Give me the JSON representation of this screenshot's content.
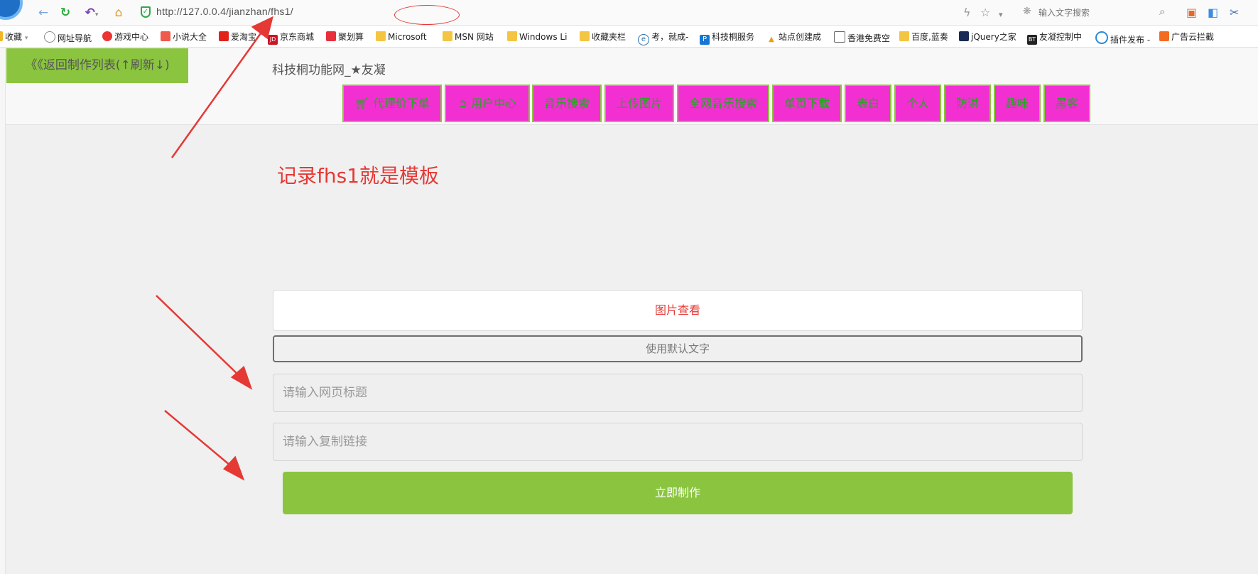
{
  "browser": {
    "url": "http://127.0.0.4/jianzhan/fhs1/",
    "search_placeholder": "输入文字搜索"
  },
  "bookmarks": [
    {
      "label": "收藏",
      "icon": "star-icon"
    },
    {
      "label": "网址导航",
      "icon": "globe-icon"
    },
    {
      "label": "游戏中心",
      "icon": "game-icon"
    },
    {
      "label": "小说大全",
      "icon": "book-icon"
    },
    {
      "label": "爱淘宝",
      "icon": "taobao-icon"
    },
    {
      "label": "京东商城",
      "icon": "jd-icon"
    },
    {
      "label": "聚划算",
      "icon": "juhuasuan-icon"
    },
    {
      "label": "Microsoft",
      "icon": "folder-icon"
    },
    {
      "label": "MSN 网站",
      "icon": "folder-icon"
    },
    {
      "label": "Windows Li",
      "icon": "folder-icon"
    },
    {
      "label": "收藏夹栏",
      "icon": "folder-icon"
    },
    {
      "label": "考，就成-",
      "icon": "e-icon"
    },
    {
      "label": "科技桐服务",
      "icon": "p-icon"
    },
    {
      "label": "站点创建成",
      "icon": "site-icon"
    },
    {
      "label": "香港免费空",
      "icon": "page-icon"
    },
    {
      "label": "百度,蓝奏",
      "icon": "folder-img-icon"
    },
    {
      "label": "jQuery之家",
      "icon": "jquery-icon"
    },
    {
      "label": "友凝控制中",
      "icon": "bt-icon"
    },
    {
      "label": "插件发布 -",
      "icon": "plugin-icon"
    },
    {
      "label": "广告云拦截",
      "icon": "flag-icon"
    }
  ],
  "page": {
    "back_label": "《《返回制作列表(↑刷新↓)",
    "site_title": "科技桐功能网_★友凝",
    "nav": [
      {
        "label": "代理价下单",
        "icon": "cart-icon"
      },
      {
        "label": "用户中心",
        "icon": "signout-icon"
      },
      {
        "label": "音乐搜索",
        "icon": ""
      },
      {
        "label": "上传图片",
        "icon": ""
      },
      {
        "label": "全网音乐搜索",
        "icon": ""
      },
      {
        "label": "单页下载",
        "icon": ""
      },
      {
        "label": "表白",
        "icon": ""
      },
      {
        "label": "个人",
        "icon": ""
      },
      {
        "label": "防洪",
        "icon": ""
      },
      {
        "label": "趣味",
        "icon": ""
      },
      {
        "label": "黑客",
        "icon": ""
      }
    ],
    "note": "记录fhs1就是模板",
    "view_image_label": "图片查看",
    "default_text_label": "使用默认文字",
    "title_placeholder": "请输入网页标题",
    "link_placeholder": "请输入复制链接",
    "submit_label": "立即制作"
  },
  "colors": {
    "accent_green": "#8bc540",
    "nav_pink": "#f230d2",
    "nav_text_green": "#1ea81e",
    "annotation_red": "#e53935"
  }
}
